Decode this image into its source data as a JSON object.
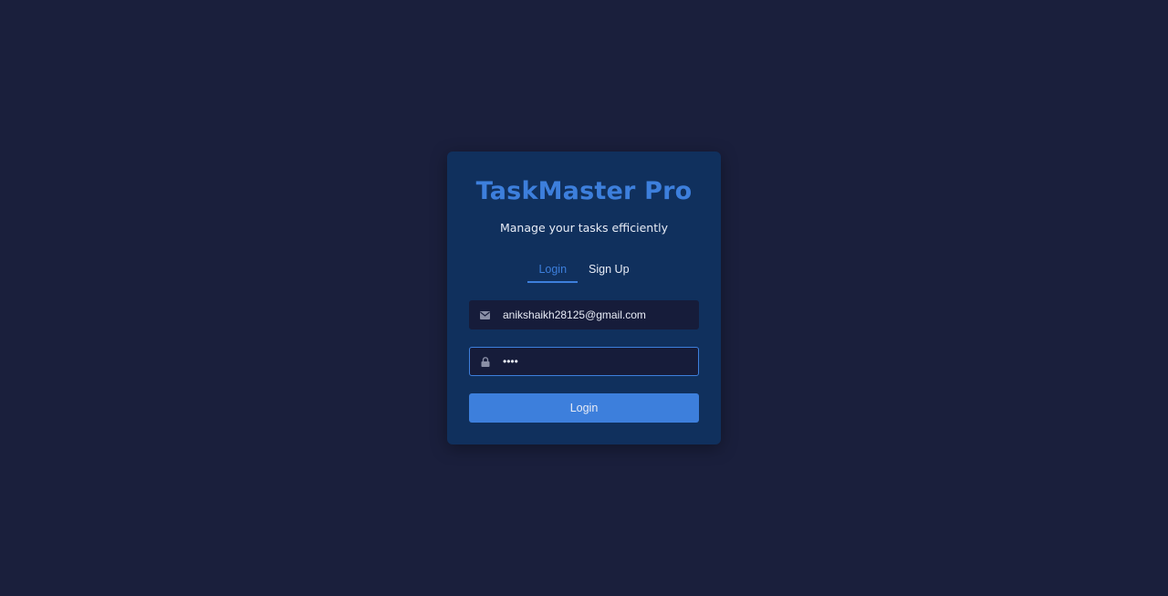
{
  "app": {
    "title": "TaskMaster Pro",
    "subtitle": "Manage your tasks efficiently"
  },
  "tabs": [
    {
      "label": "Login",
      "active": true
    },
    {
      "label": "Sign Up",
      "active": false
    }
  ],
  "form": {
    "email": {
      "value": "anikshaikh28125@gmail.com",
      "icon": "envelope-icon"
    },
    "password": {
      "value": "••••",
      "icon": "lock-icon"
    },
    "submit_label": "Login"
  },
  "colors": {
    "background": "#1a1f3c",
    "card": "#10305d",
    "accent": "#3d7fdc",
    "input_bg": "#161c3a",
    "text": "#e8ecf6"
  }
}
